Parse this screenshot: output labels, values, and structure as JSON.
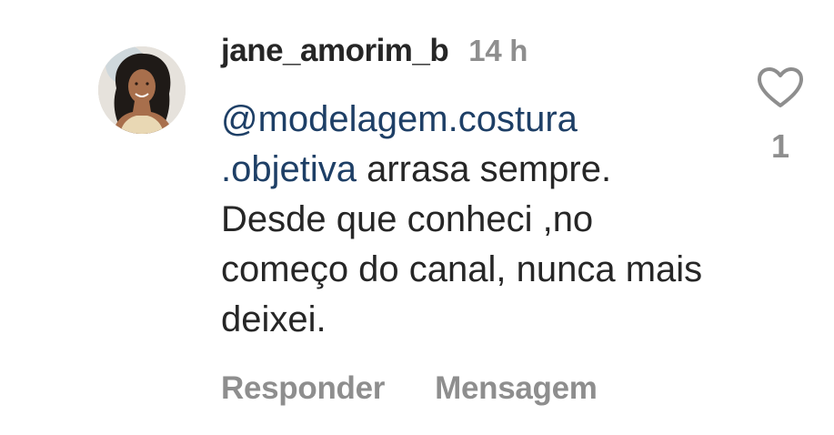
{
  "comment": {
    "username": "jane_amorim_b",
    "timestamp": "14 h",
    "mention": "@modelagem.costura .objetiva",
    "text": " arrasa sempre. Desde que conheci ,no começo do canal, nunca mais deixei.",
    "like_count": "1",
    "actions": {
      "reply_label": "Responder",
      "message_label": "Mensagem"
    }
  },
  "icons": {
    "like": "heart-outline-icon",
    "avatar": "user-avatar"
  },
  "colors": {
    "username": "#262626",
    "secondary": "#8e8e8e",
    "mention": "#1e3f66",
    "background": "#ffffff"
  }
}
